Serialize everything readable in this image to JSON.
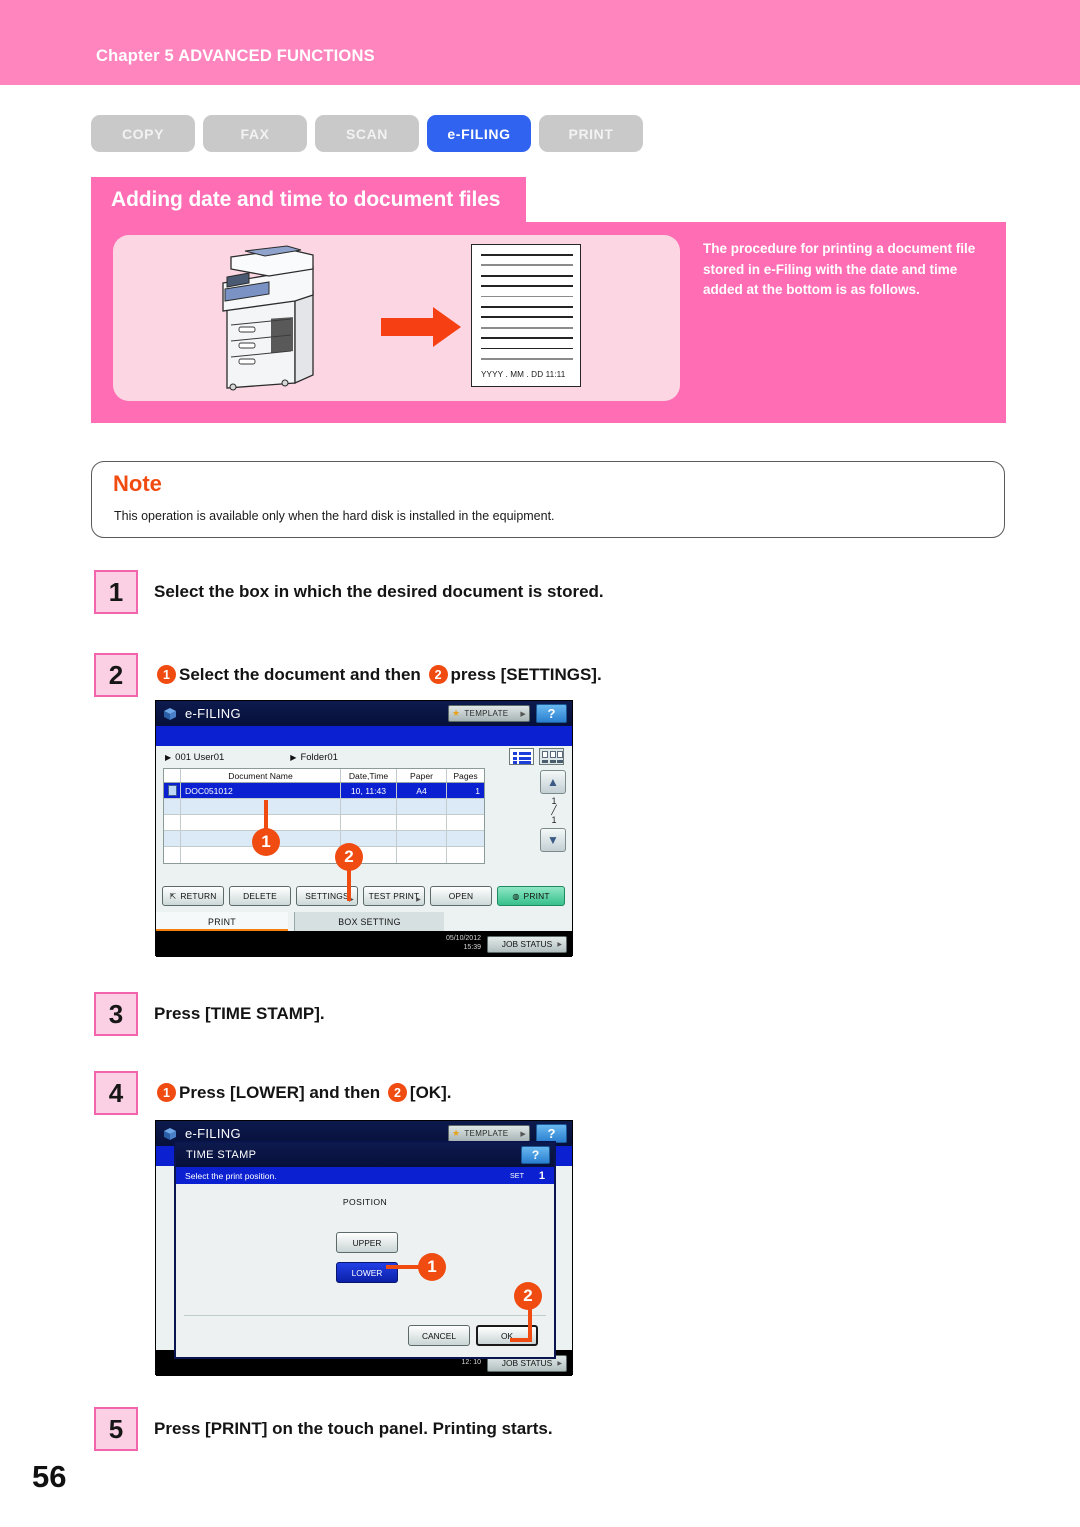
{
  "header": {
    "chapter": "Chapter 5 ADVANCED FUNCTIONS",
    "bar_color": "#FF85BF"
  },
  "function_tabs": [
    {
      "label": "COPY",
      "active": false
    },
    {
      "label": "FAX",
      "active": false
    },
    {
      "label": "SCAN",
      "active": false
    },
    {
      "label": "e-FILING",
      "active": true
    },
    {
      "label": "PRINT",
      "active": false
    }
  ],
  "feature": {
    "title": "Adding date and time to document files",
    "description": "The procedure for printing a document file stored in e-Filing with the date and time added at the bottom is as follows.",
    "page_stamp": "YYYY . MM . DD 11:11",
    "banner_color": "#FF6EB4",
    "accent_color": "#F04C12"
  },
  "note": {
    "title": "Note",
    "text": "This operation is available only when the hard disk is installed in the equipment."
  },
  "steps": [
    {
      "num": "1",
      "text": "Select the box in which the desired document is stored."
    },
    {
      "num": "2",
      "pre": "",
      "b1": "1",
      "mid": "Select the document and then ",
      "b2": "2",
      "post": "press [SETTINGS]."
    },
    {
      "num": "3",
      "text": "Press [TIME STAMP]."
    },
    {
      "num": "4",
      "pre": "",
      "b1": "1",
      "mid": "Press [LOWER] and then ",
      "b2": "2",
      "post": "[OK]."
    },
    {
      "num": "5",
      "text": "Press [PRINT] on the touch panel. Printing starts."
    }
  ],
  "panel1": {
    "app_title": "e-FILING",
    "app_icon": "efiling-icon",
    "template_button": "TEMPLATE",
    "help_button": "?",
    "breadcrumbs": [
      {
        "label": "001 User01"
      },
      {
        "label": "Folder01"
      }
    ],
    "view_icons": [
      "list-view-icon",
      "thumbnail-view-icon"
    ],
    "table": {
      "columns": [
        "Document Name",
        "Date,Time",
        "Paper",
        "Pages"
      ],
      "rows": [
        {
          "name": "DOC051012",
          "date": "10, 11:43",
          "paper": "A4",
          "pages": "1",
          "selected": true
        },
        {
          "name": "",
          "date": "",
          "paper": "",
          "pages": "",
          "selected": false
        },
        {
          "name": "",
          "date": "",
          "paper": "",
          "pages": "",
          "selected": false
        },
        {
          "name": "",
          "date": "",
          "paper": "",
          "pages": "",
          "selected": false
        },
        {
          "name": "",
          "date": "",
          "paper": "",
          "pages": "",
          "selected": false
        }
      ]
    },
    "scroll": {
      "up": "scroll-up-icon",
      "down": "scroll-down-icon",
      "current": "1",
      "total": "1"
    },
    "buttons": [
      {
        "label": "RETURN",
        "style": "plain",
        "sub": false
      },
      {
        "label": "DELETE",
        "style": "plain",
        "sub": false
      },
      {
        "label": "SETTINGS",
        "style": "plain",
        "sub": true
      },
      {
        "label": "TEST PRINT",
        "style": "plain",
        "sub": true
      },
      {
        "label": "OPEN",
        "style": "plain",
        "sub": false
      },
      {
        "label": "PRINT",
        "style": "green",
        "sub": false
      }
    ],
    "tabs": [
      {
        "label": "PRINT",
        "active": true
      },
      {
        "label": "BOX SETTING",
        "active": false
      }
    ],
    "status": {
      "date": "05/10/2012",
      "time": "15:39",
      "job_button": "JOB STATUS"
    },
    "callouts": [
      "1",
      "2"
    ]
  },
  "panel2": {
    "app_title": "e-FILING",
    "template_button": "TEMPLATE",
    "help_button": "?",
    "dialog": {
      "title": "TIME STAMP",
      "help_button": "?",
      "prompt": "Select the print position.",
      "set_label": "SET",
      "set_value": "1",
      "section_label": "POSITION",
      "options": [
        {
          "label": "UPPER",
          "selected": false
        },
        {
          "label": "LOWER",
          "selected": true
        }
      ],
      "footer_buttons": [
        {
          "label": "CANCEL",
          "emphasis": false
        },
        {
          "label": "OK",
          "emphasis": true
        }
      ]
    },
    "status": {
      "time": "12: 10",
      "job_button": "JOB STATUS"
    },
    "callouts": [
      "1",
      "2"
    ]
  },
  "page_number": "56"
}
